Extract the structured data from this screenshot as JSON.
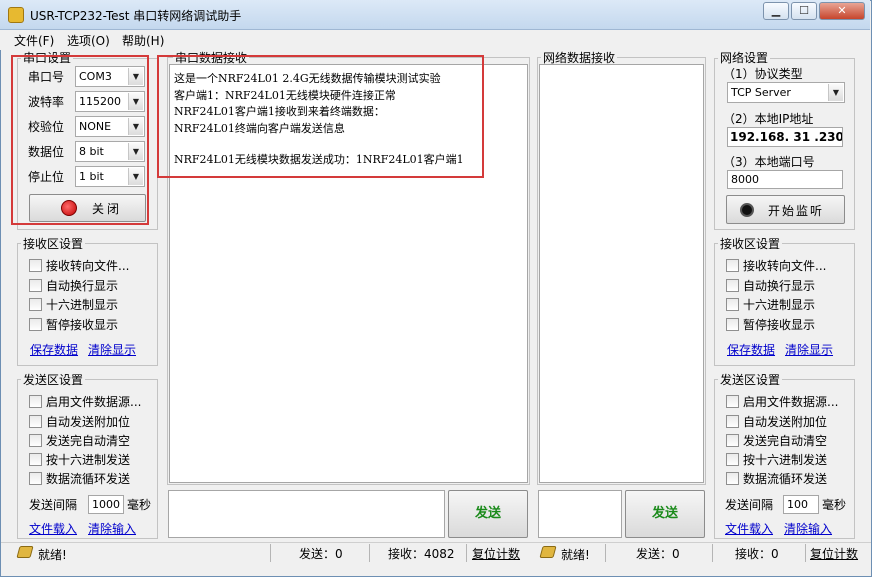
{
  "window": {
    "title": "USR-TCP232-Test 串口转网络调试助手",
    "min_label": "▁",
    "max_label": "☐",
    "close_label": "✕"
  },
  "menu": [
    "文件(F)",
    "选项(O)",
    "帮助(H)"
  ],
  "serial": {
    "title": "串口设置",
    "fields": [
      {
        "label": "串口号",
        "value": "COM3"
      },
      {
        "label": "波特率",
        "value": "115200"
      },
      {
        "label": "校验位",
        "value": "NONE"
      },
      {
        "label": "数据位",
        "value": "8 bit"
      },
      {
        "label": "停止位",
        "value": "1 bit"
      }
    ],
    "toggle_label": "关闭"
  },
  "left_recv": {
    "title": "接收区设置",
    "options": [
      "接收转向文件...",
      "自动换行显示",
      "十六进制显示",
      "暂停接收显示"
    ],
    "save_link": "保存数据",
    "clear_link": "清除显示"
  },
  "left_send": {
    "title": "发送区设置",
    "options": [
      "启用文件数据源...",
      "自动发送附加位",
      "发送完自动清空",
      "按十六进制发送",
      "数据流循环发送"
    ],
    "interval_label": "发送间隔",
    "interval_value": "1000",
    "interval_unit": "毫秒",
    "load_link": "文件载入",
    "clear_link": "清除输入"
  },
  "serial_recv": {
    "title": "串口数据接收",
    "lines": [
      "这是一个NRF24L01 2.4G无线数据传输模块测试实验",
      "客户端1：NRF24L01无线模块硬件连接正常",
      "NRF24L01客户端1接收到来着终端数据：",
      "NRF24L01终端向客户端发送信息",
      "",
      "NRF24L01无线模块数据发送成功：1NRF24L01客户端1"
    ]
  },
  "net_recv": {
    "title": "网络数据接收"
  },
  "network": {
    "title": "网络设置",
    "protocol_label": "（1）协议类型",
    "protocol_value": "TCP Server",
    "ip_label": "（2）本地IP地址",
    "ip_value": "192.168. 31 .230",
    "port_label": "（3）本地端口号",
    "port_value": "8000",
    "listen_label": "开始监听"
  },
  "right_recv": {
    "title": "接收区设置",
    "options": [
      "接收转向文件...",
      "自动换行显示",
      "十六进制显示",
      "暂停接收显示"
    ],
    "save_link": "保存数据",
    "clear_link": "清除显示"
  },
  "right_send": {
    "title": "发送区设置",
    "options": [
      "启用文件数据源...",
      "自动发送附加位",
      "发送完自动清空",
      "按十六进制发送",
      "数据流循环发送"
    ],
    "interval_label": "发送间隔",
    "interval_value": "100",
    "interval_unit": "毫秒",
    "load_link": "文件载入",
    "clear_link": "清除输入"
  },
  "send_button": "发送",
  "status_left": {
    "ready": "就绪!",
    "sent": "发送：0",
    "received": "接收：4082",
    "reset": "复位计数"
  },
  "status_right": {
    "ready": "就绪!",
    "sent": "发送：0",
    "received": "接收：0",
    "reset": "复位计数"
  },
  "colors": {
    "highlight": "#d43a3a",
    "send_text": "#1a8a1a",
    "link": "#0000cc"
  },
  "icons": [
    "app-icon",
    "record-icon",
    "pen-icon"
  ]
}
